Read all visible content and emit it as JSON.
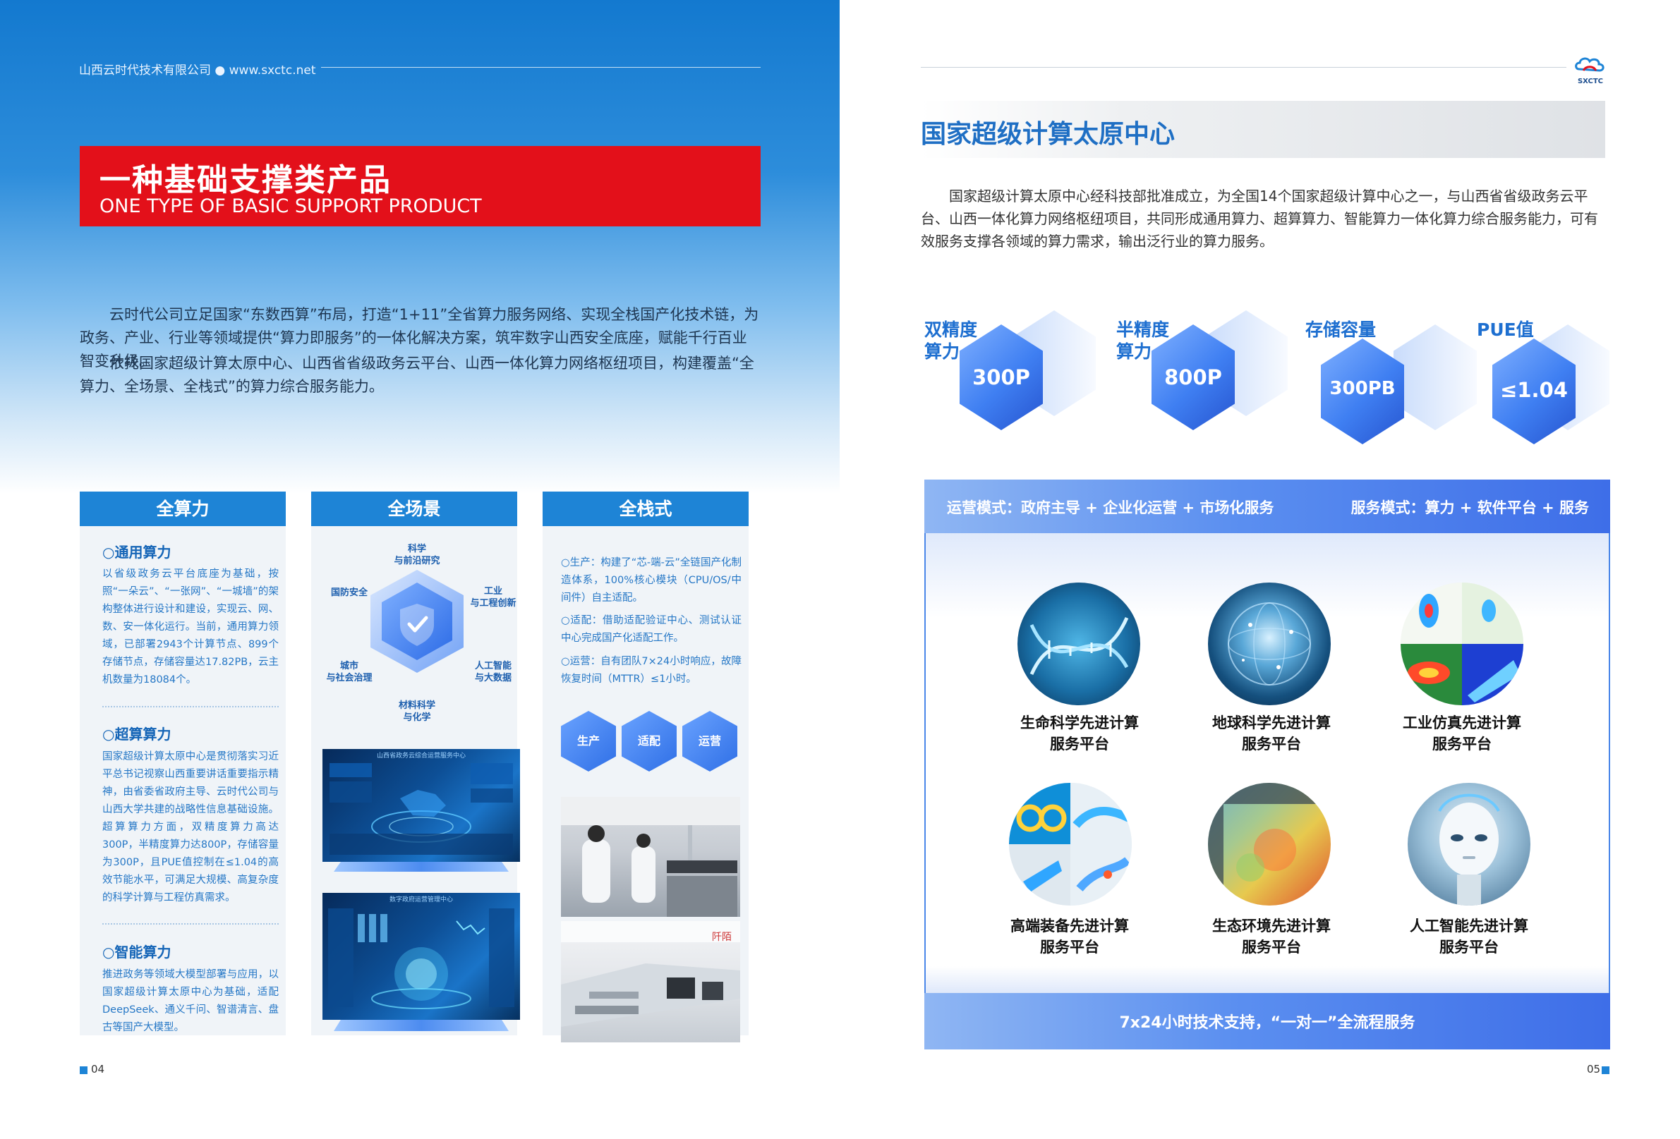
{
  "left": {
    "header": {
      "company": "山西云时代技术有限公司",
      "website": "www.sxctc.net"
    },
    "title": {
      "zh": "一种基础支撑类产品",
      "en": "ONE TYPE OF BASIC SUPPORT PRODUCT"
    },
    "intro": [
      "云时代公司立足国家“东数西算”布局，打造“1+11”全省算力服务网络、实现全栈国产化技术链，为政务、产业、行业等领域提供“算力即服务”的一体化解决方案，筑牢数字山西安全底座，赋能千行百业智变升级。",
      "依托国家超级计算太原中心、山西省省级政务云平台、山西一体化算力网络枢纽项目，构建覆盖“全算力、全场景、全栈式”的算力综合服务能力。"
    ],
    "columns": {
      "compute": {
        "title": "全算力",
        "sections": [
          {
            "heading": "○通用算力",
            "text": "以省级政务云平台底座为基础，按照“一朵云”、“一张网”、“一城墙”的架构整体进行设计和建设，实现云、网、数、安一体化运行。当前，通用算力领域，已部署2943个计算节点、899个存储节点，存储容量达17.82PB，云主机数量为18084个。"
          },
          {
            "heading": "○超算算力",
            "text": "国家超级计算太原中心是贯彻落实习近平总书记视察山西重要讲话重要指示精神，由省委省政府主导、云时代公司与山西大学共建的战略性信息基础设施。超算算力方面，双精度算力高达300P，半精度算力达800P，存储容量为300P，且PUE值控制在≤1.04的高效节能水平，可满足大规模、高复杂度的科学计算与工程仿真需求。"
          },
          {
            "heading": "○智能算力",
            "text": "推进政务等领域大模型部署与应用，以国家超级计算太原中心为基础，适配DeepSeek、通义千问、智谱清言、盘古等国产大模型。"
          }
        ]
      },
      "scene": {
        "title": "全场景",
        "hex_labels": {
          "top": "科学\n与前沿研究",
          "top_right": "工业\n与工程创新",
          "bottom_right": "人工智能\n与大数据",
          "bottom": "材料科学\n与化学",
          "bottom_left": "城市\n与社会治理",
          "top_left": "国防安全"
        },
        "screen_top_caption": "山西省政务云综合运营服务中心",
        "screen_bottom_caption": "数字政府运营管理中心"
      },
      "stack": {
        "title": "全栈式",
        "items": [
          "○生产：构建了“芯-端-云”全链国产化制造体系，100%核心模块（CPU/OS/中间件）自主适配。",
          "○适配：借助适配验证中心、测试认证中心完成国产化适配工作。",
          "○运营：自有团队7×24小时响应，故障恢复时间（MTTR）≤1小时。"
        ],
        "hexes": [
          "生产",
          "适配",
          "运营"
        ],
        "factory_sign": "阡陌"
      }
    },
    "page_number": "04"
  },
  "right": {
    "logo": "SXCTC",
    "section_title": "国家超级计算太原中心",
    "intro": "国家超级计算太原中心经科技部批准成立，为全国14个国家超级计算中心之一，与山西省省级政务云平台、山西一体化算力网络枢纽项目，共同形成通用算力、超算算力、智能算力一体化算力综合服务能力，可有效服务支撑各领域的算力需求，输出泛行业的算力服务。",
    "stats": [
      {
        "label": "双精度\n算力",
        "value": "300P"
      },
      {
        "label": "半精度\n算力",
        "value": "800P"
      },
      {
        "label": "存储容量",
        "value": "300PB"
      },
      {
        "label": "PUE值",
        "value": "≤1.04"
      }
    ],
    "modes": {
      "operation": "运营模式：政府主导 + 企业化运营 + 市场化服务",
      "service": "服务模式：算力 + 软件平台 + 服务"
    },
    "platforms": [
      {
        "name": "生命科学先进计算\n服务平台",
        "icon": "dna-icon"
      },
      {
        "name": "地球科学先进计算\n服务平台",
        "icon": "earth-icon"
      },
      {
        "name": "工业仿真先进计算\n服务平台",
        "icon": "simulation-icon"
      },
      {
        "name": "高端装备先进计算\n服务平台",
        "icon": "equipment-icon"
      },
      {
        "name": "生态环境先进计算\n服务平台",
        "icon": "environment-icon"
      },
      {
        "name": "人工智能先进计算\n服务平台",
        "icon": "ai-robot-icon"
      }
    ],
    "support": "7x24小时技术支持，“一对一”全流程服务",
    "page_number": "05"
  },
  "colors": {
    "brand_red": "#e3101a",
    "brand_blue": "#1e84d6",
    "accent_blue": "#1f6fc4"
  }
}
